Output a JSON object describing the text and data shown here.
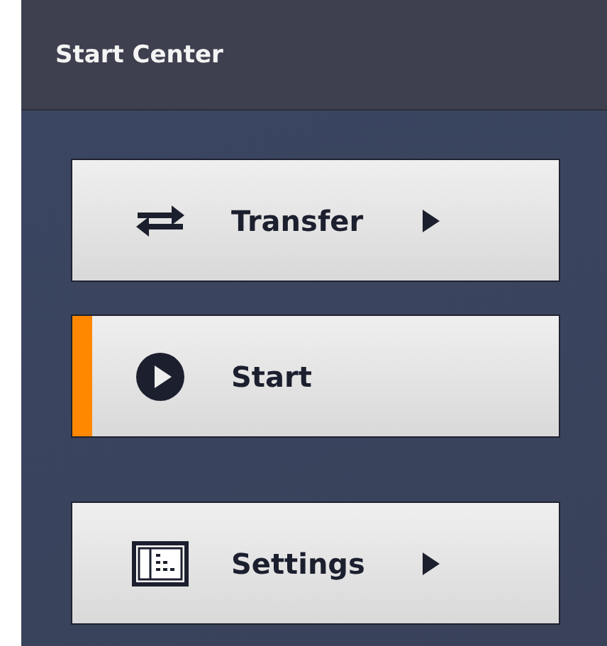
{
  "panel": {
    "title": "Start Center"
  },
  "groups": [
    [
      {
        "label": "Transfer",
        "kind": "transfer",
        "selected": false,
        "submenu": true
      },
      {
        "label": "Start",
        "kind": "play",
        "selected": true,
        "submenu": false
      }
    ],
    [
      {
        "label": "Settings",
        "kind": "settings",
        "selected": false,
        "submenu": true
      }
    ]
  ]
}
